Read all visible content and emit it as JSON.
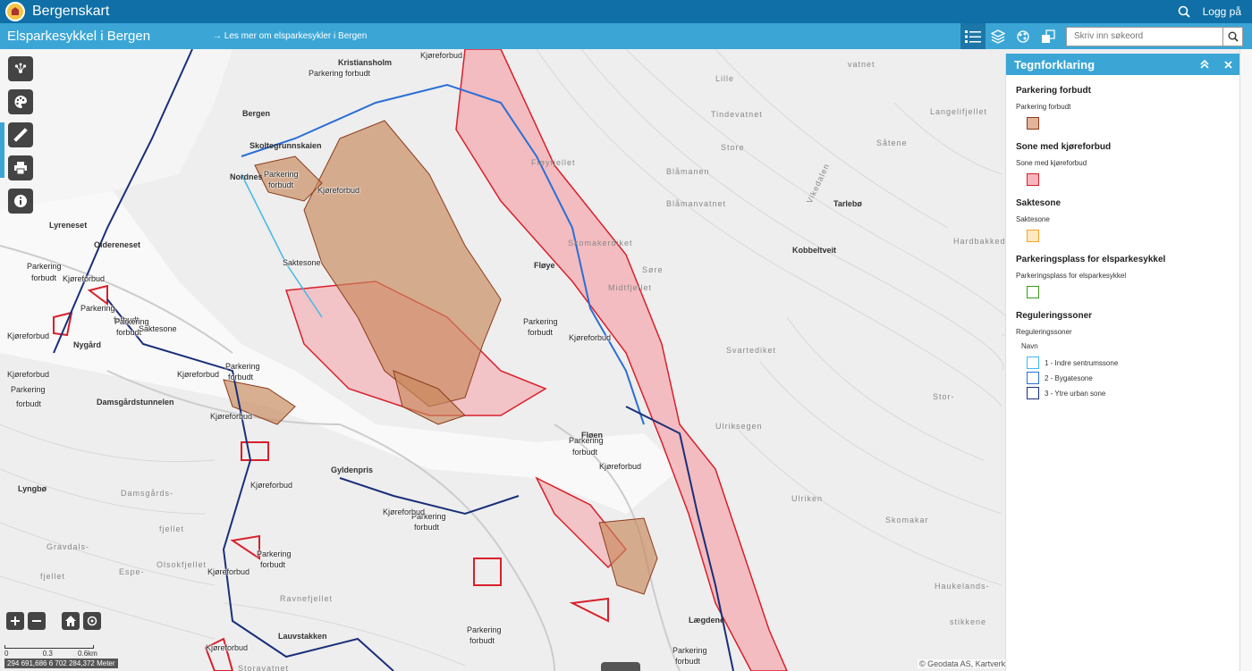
{
  "header": {
    "app_title": "Bergenskart",
    "login_label": "Logg på"
  },
  "subheader": {
    "map_title": "Elsparkesykkel i Bergen",
    "read_more_link": "→ Les mer om elsparkesykler i Bergen",
    "search_placeholder": "Skriv inn søkeord"
  },
  "icons": {
    "crest": "bergen-crest-icon",
    "top_search": "search-icon",
    "tools": [
      "legend-list-icon",
      "layers-icon",
      "basemap-icon",
      "overview-icon"
    ],
    "left_tools": [
      "share-icon",
      "palette-icon",
      "measure-icon",
      "print-icon",
      "info-icon"
    ]
  },
  "map": {
    "place_labels": [
      {
        "text": "Kristiansholm",
        "cls": "dark"
      },
      {
        "text": "Bergen",
        "cls": "dark"
      },
      {
        "text": "Skoltegrunnskaien",
        "cls": "dark"
      },
      {
        "text": "Nordnes",
        "cls": "dark"
      },
      {
        "text": "Lyreneset",
        "cls": "dark"
      },
      {
        "text": "Oldereneset",
        "cls": "dark"
      },
      {
        "text": "Nygård",
        "cls": "dark"
      },
      {
        "text": "Damsgårdstunnelen",
        "cls": "dark"
      },
      {
        "text": "Lyngbø",
        "cls": "dark"
      },
      {
        "text": "Damsgårds-",
        "cls": ""
      },
      {
        "text": "fjellet",
        "cls": ""
      },
      {
        "text": "Gravdals-",
        "cls": ""
      },
      {
        "text": "fjellet",
        "cls": ""
      },
      {
        "text": "Olsokfjellet",
        "cls": ""
      },
      {
        "text": "Espe-",
        "cls": ""
      },
      {
        "text": "Ravnefjellet",
        "cls": ""
      },
      {
        "text": "Lauvstakken",
        "cls": "dark"
      },
      {
        "text": "Fløyfjellet",
        "cls": ""
      },
      {
        "text": "Fløye",
        "cls": "dark"
      },
      {
        "text": "Midtfjellet",
        "cls": ""
      },
      {
        "text": "Blåmanen",
        "cls": ""
      },
      {
        "text": "Skomakerdiket",
        "cls": ""
      },
      {
        "text": "Tindevatnet",
        "cls": ""
      },
      {
        "text": "Store",
        "cls": ""
      },
      {
        "text": "Lille",
        "cls": ""
      },
      {
        "text": "Søre",
        "cls": ""
      },
      {
        "text": "Blåmanvatnet",
        "cls": ""
      },
      {
        "text": "Tarlebø",
        "cls": "dark"
      },
      {
        "text": "Kobbeltveit",
        "cls": "dark"
      },
      {
        "text": "Vikedalen",
        "cls": ""
      },
      {
        "text": "Langelifjellet",
        "cls": ""
      },
      {
        "text": "Såtene",
        "cls": ""
      },
      {
        "text": "Hardbakkedalen",
        "cls": ""
      },
      {
        "text": "Ulriksegen",
        "cls": ""
      },
      {
        "text": "Stor-",
        "cls": ""
      },
      {
        "text": "Ulriken",
        "cls": ""
      },
      {
        "text": "Skomakar",
        "cls": ""
      },
      {
        "text": "Haukelands-",
        "cls": ""
      },
      {
        "text": "stikkene",
        "cls": ""
      },
      {
        "text": "Fløen",
        "cls": "dark"
      },
      {
        "text": "Lægdene",
        "cls": "dark"
      },
      {
        "text": "Gyldenpris",
        "cls": "dark"
      },
      {
        "text": "Storavatnet",
        "cls": ""
      },
      {
        "text": "vatnet",
        "cls": ""
      },
      {
        "text": "Svartediket",
        "cls": ""
      }
    ],
    "feature_labels": [
      "Kjøreforbud",
      "Parkering forbudt",
      "Parkering",
      "forbudt",
      "Saktesone",
      "Kjøreforbud",
      "Parkering",
      "forbudt",
      "Kjøreforbud",
      "Parkering",
      "forbudt",
      "Kjøreforbud",
      "Parkering",
      "forbudt",
      "Saktesone",
      "Kjøreforbud",
      "Parkering",
      "forbudt",
      "Kjøreforbud",
      "Parkering",
      "forbudt",
      "Kjøreforbud",
      "Kjøreforbud",
      "Parkering",
      "forbudt",
      "Kjøreforbud",
      "Parkering",
      "forbudt",
      "Kjøreforbud",
      "Parkering",
      "forbudt",
      "Kjøreforbud",
      "Parkering",
      "forbudt",
      "Kjøreforbud",
      "Parkering",
      "forbudt",
      "Kjøreforbud",
      "Parkering",
      "forbudt"
    ],
    "scale": {
      "labels": [
        "0",
        "0.3",
        "0.6km"
      ]
    },
    "coordinates": "294 691,686 6 702 284,372 Meter",
    "attribution": "© Geodata AS, Kartverket"
  },
  "legend": {
    "title": "Tegnforklaring",
    "sections": [
      {
        "title": "Parkering forbudt",
        "sub": "Parkering forbudt",
        "fill": "#e2b49a",
        "stroke": "#8b3a1a"
      },
      {
        "title": "Sone med kjøreforbud",
        "sub": "Sone med kjøreforbud",
        "fill": "#f7b6bd",
        "stroke": "#d8202b"
      },
      {
        "title": "Saktesone",
        "sub": "Saktesone",
        "fill": "#fde8c2",
        "stroke": "#f5a623"
      },
      {
        "title": "Parkeringsplass for elsparkesykkel",
        "sub": "Parkeringsplass for elsparkesykkel",
        "fill": "#ffffff",
        "stroke": "#3a9a1a"
      }
    ],
    "regulering": {
      "title": "Reguleringssoner",
      "sub": "Reguleringssoner",
      "navn": "Navn",
      "zones": [
        {
          "label": "1 - Indre sentrumssone",
          "stroke": "#41b8e8"
        },
        {
          "label": "2 - Bygatesone",
          "stroke": "#2a6fd6"
        },
        {
          "label": "3 - Ytre urban sone",
          "stroke": "#1a2f7a"
        }
      ]
    }
  }
}
